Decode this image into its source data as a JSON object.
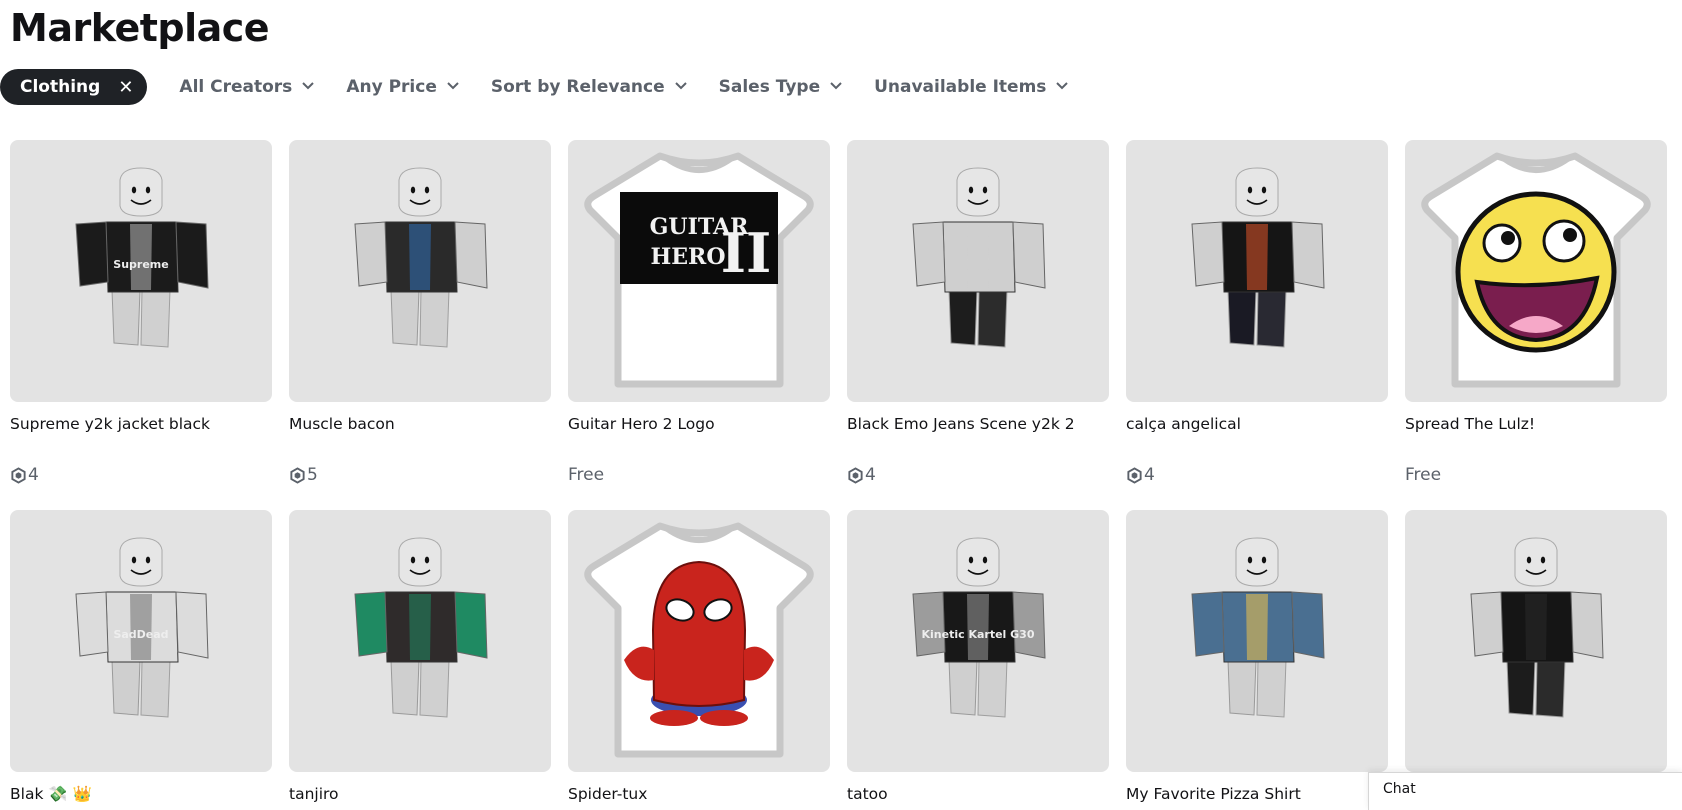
{
  "page": {
    "title": "Marketplace"
  },
  "filters": {
    "active_chip": "Clothing",
    "dropdowns": [
      "All Creators",
      "Any Price",
      "Sort by Relevance",
      "Sales Type",
      "Unavailable Items"
    ]
  },
  "items": [
    {
      "name": "Supreme y2k jacket black",
      "price": "4",
      "currency": "robux",
      "thumb": "avatar",
      "shirt": "#1b1b1b",
      "accent": "#b8b8b8",
      "legs": "#cfcfcf",
      "arms": "#1b1b1b",
      "graphic_text": "Supreme"
    },
    {
      "name": "Muscle bacon",
      "price": "5",
      "currency": "robux",
      "thumb": "avatar",
      "shirt": "#2a2a2a",
      "accent": "#2f6fb7",
      "legs": "#cfcfcf",
      "arms": "#cfcfcf"
    },
    {
      "name": "Guitar Hero 2 Logo",
      "price": "Free",
      "currency": "free",
      "thumb": "tshirt",
      "graphic": "guitarhero",
      "graphic_text": "GUITAR HERO II"
    },
    {
      "name": "Black Emo Jeans Scene y2k 2",
      "price": "4",
      "currency": "robux",
      "thumb": "avatar",
      "shirt": "#cfcfcf",
      "accent": "#cfcfcf",
      "legs": "#1d1d1d",
      "arms": "#cfcfcf"
    },
    {
      "name": "calça angelical",
      "price": "4",
      "currency": "robux",
      "thumb": "avatar",
      "shirt": "#151515",
      "accent": "#e2552a",
      "legs": "#1a1a24",
      "arms": "#cfcfcf"
    },
    {
      "name": "Spread The Lulz!",
      "price": "Free",
      "currency": "free",
      "thumb": "tshirt",
      "graphic": "smiley"
    },
    {
      "name": "Blak 💸 👑",
      "price": "",
      "currency": "robux",
      "thumb": "avatar",
      "shirt": "#dcdcdc",
      "accent": "#6f6f6f",
      "legs": "#cfcfcf",
      "arms": "#dcdcdc",
      "graphic_text": "SadDead"
    },
    {
      "name": "tanjiro",
      "price": "",
      "currency": "robux",
      "thumb": "avatar",
      "shirt": "#2f2b2b",
      "accent": "#1f8a62",
      "legs": "#cfcfcf",
      "arms": "#1f8a62"
    },
    {
      "name": "Spider-tux",
      "price": "",
      "currency": "free",
      "thumb": "tshirt",
      "graphic": "spider"
    },
    {
      "name": "tatoo",
      "price": "",
      "currency": "robux",
      "thumb": "avatar",
      "shirt": "#181818",
      "accent": "#9c9c9c",
      "legs": "#cfcfcf",
      "arms": "#9c9c9c",
      "graphic_text": "Kinetic Kartel G30"
    },
    {
      "name": "My Favorite Pizza Shirt",
      "price": "",
      "currency": "robux",
      "thumb": "avatar",
      "shirt": "#4a6f91",
      "accent": "#f0c24a",
      "legs": "#cfcfcf",
      "arms": "#4a6f91"
    },
    {
      "name": "",
      "price": "",
      "currency": "robux",
      "thumb": "avatar",
      "shirt": "#151515",
      "accent": "#2a2a2a",
      "legs": "#1c1c1c",
      "arms": "#cfcfcf"
    }
  ],
  "chat": {
    "label": "Chat"
  }
}
